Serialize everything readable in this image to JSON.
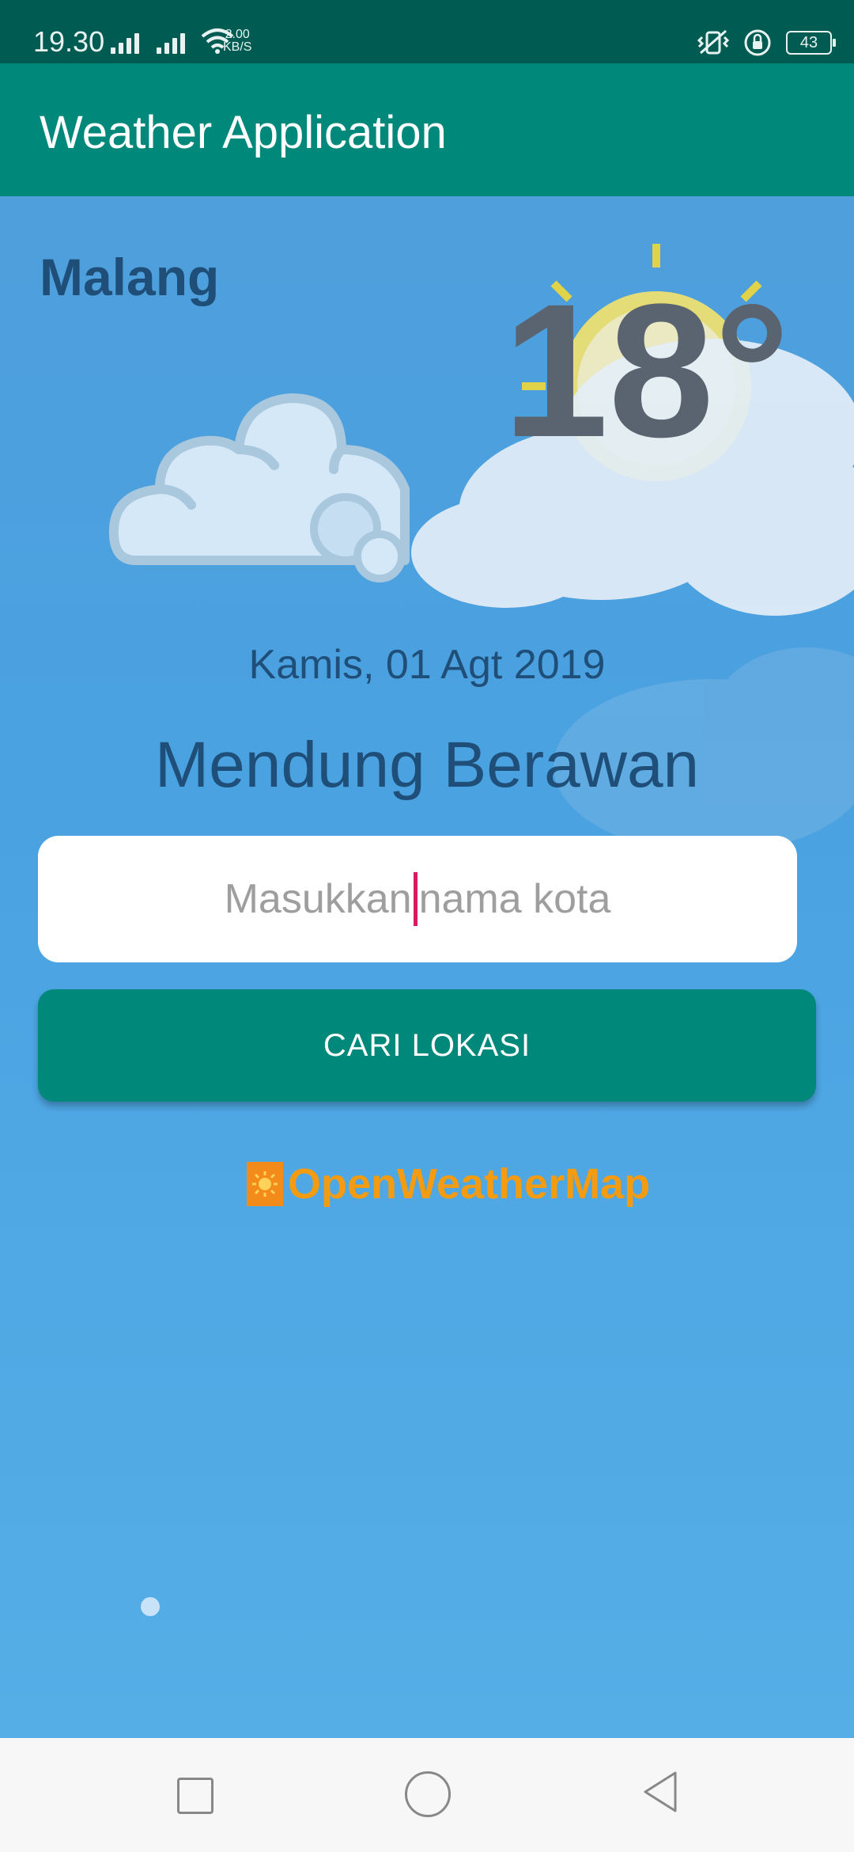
{
  "status_bar": {
    "time": "19.30",
    "net_speed_value": "2.00",
    "net_speed_unit": "KB/S",
    "battery": "43",
    "icons": [
      "signal-icon",
      "signal-icon",
      "wifi-icon",
      "vibrate-icon",
      "rotation-lock-icon",
      "battery-icon"
    ]
  },
  "app_bar": {
    "title": "Weather Application"
  },
  "weather": {
    "city": "Malang",
    "temperature": "18°",
    "date": "Kamis, 01 Agt 2019",
    "description": "Mendung Berawan",
    "icon": "cloud-icon"
  },
  "search": {
    "placeholder_part1": "Masukkan",
    "placeholder_part2": "nama kota",
    "button_label": "CARI LOKASI"
  },
  "attribution": {
    "text": "OpenWeatherMap"
  },
  "nav_bar": {
    "icons": [
      "recents-icon",
      "home-icon",
      "back-icon"
    ]
  },
  "colors": {
    "primary": "#00897b",
    "primary_dark": "#005c52",
    "accent": "#d81b60",
    "text_dark": "#1f4f78",
    "attribution": "#f39c12"
  }
}
